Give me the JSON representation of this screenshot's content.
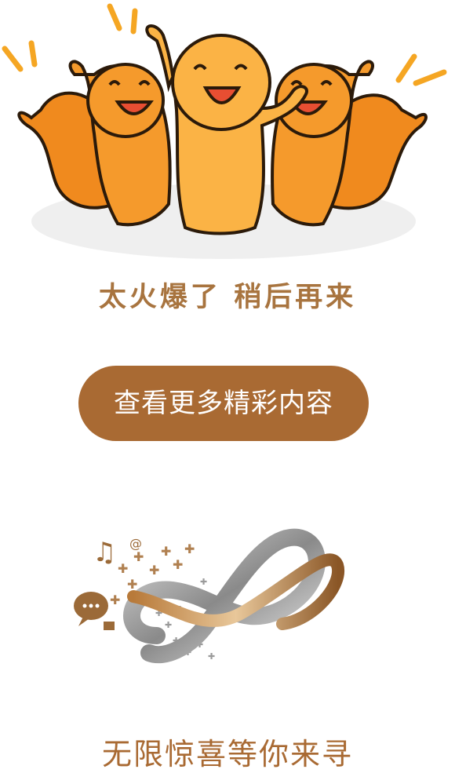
{
  "headline": "太火爆了 稍后再来",
  "cta_label": "查看更多精彩内容",
  "footer_slogan": "无限惊喜等你来寻",
  "colors": {
    "accent": "#a96a33",
    "headline": "#a8743f",
    "mascot_orange": "#f59a2c",
    "mascot_center": "#fbb345",
    "background": "#ffffff"
  },
  "icons": {
    "mascots": "cheering-mascots-illustration",
    "infinity": "infinity-loop-icon",
    "music": "music-note-icon",
    "chat": "chat-bubble-icon",
    "book": "book-icon",
    "at": "at-sign-icon"
  }
}
